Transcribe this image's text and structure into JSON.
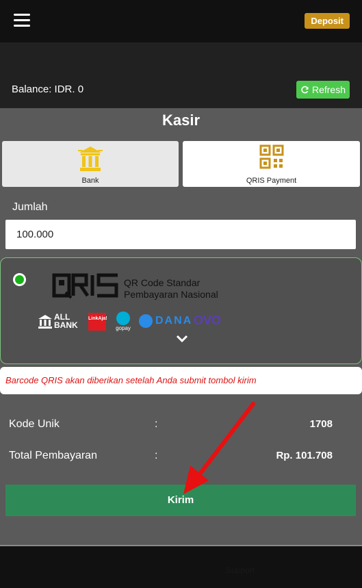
{
  "header": {
    "deposit_label": "Deposit"
  },
  "balance": {
    "text": "Balance: IDR. 0",
    "refresh_label": "Refresh"
  },
  "page": {
    "title": "Kasir"
  },
  "methods": [
    {
      "label": "Bank",
      "icon": "bank-icon"
    },
    {
      "label": "QRIS Payment",
      "icon": "qr-code-icon"
    }
  ],
  "form": {
    "amount_label": "Jumlah",
    "amount_value": "100.000"
  },
  "qris": {
    "logo_text": "QRIS",
    "subtitle_line1": "QR Code Standar",
    "subtitle_line2": "Pembayaran Nasional",
    "partners": [
      "ALL BANK",
      "LinkAja!",
      "gopay",
      "DANA",
      "OVO"
    ]
  },
  "notice": "Barcode QRIS akan diberikan setelah Anda submit tombol kirim",
  "summary": [
    {
      "label": "Kode Unik",
      "colon": ":",
      "value": "1708"
    },
    {
      "label": "Total Pembayaran",
      "colon": ":",
      "value": "Rp. 101.708"
    }
  ],
  "submit_label": "Kirim",
  "footer": {
    "text": "Support"
  },
  "colors": {
    "deposit": "#c8921a",
    "refresh": "#4cc94c",
    "submit": "#2e8b57",
    "notice_text": "#dd1111",
    "annotation_arrow": "#e81010"
  }
}
